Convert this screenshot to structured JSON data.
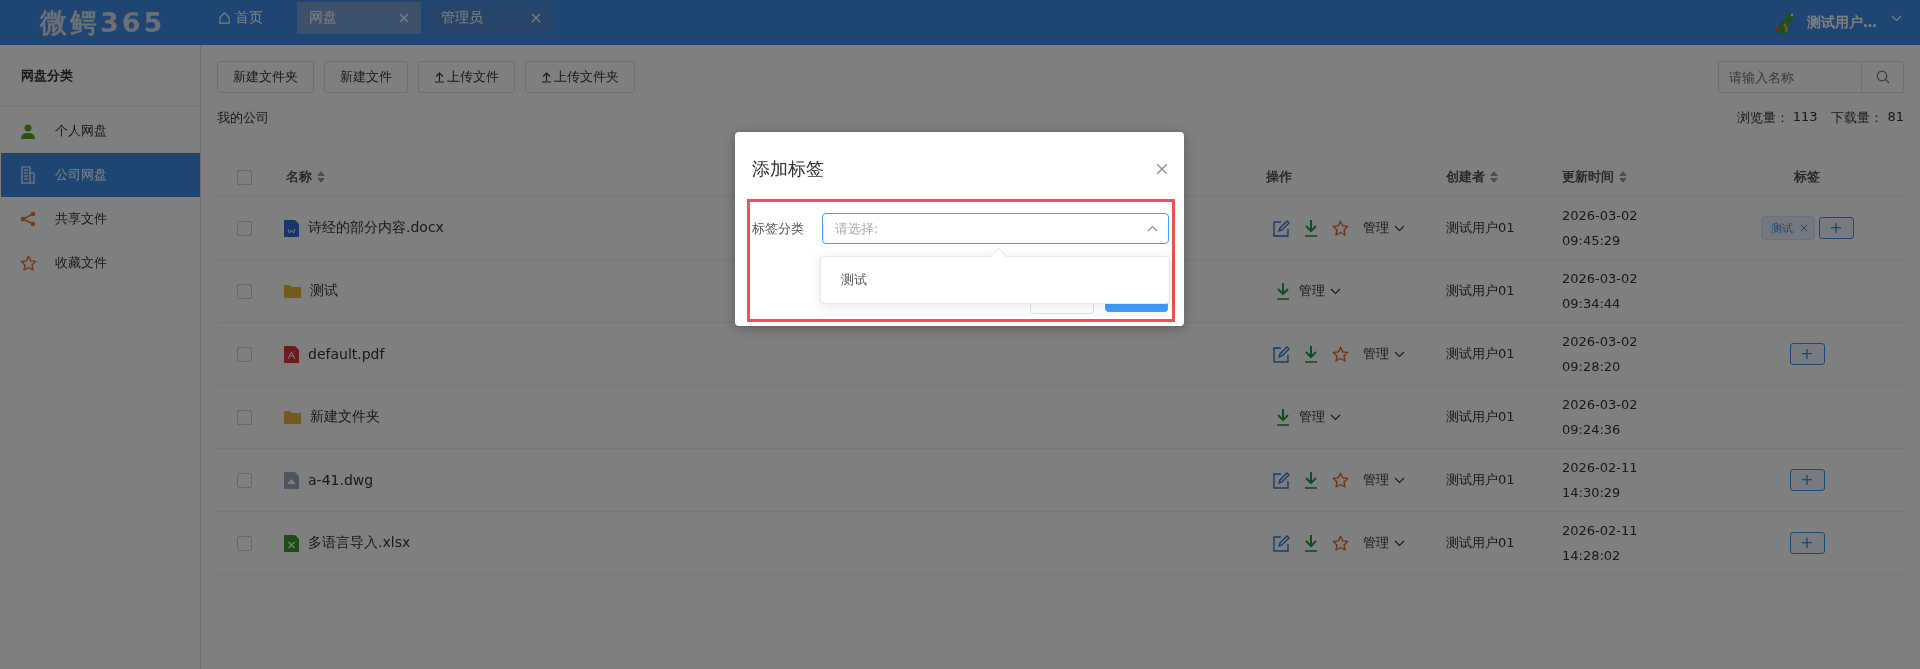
{
  "header": {
    "logo": "微鳄365",
    "tabs": [
      {
        "label": "首页",
        "kind": "home",
        "selected": false
      },
      {
        "label": "网盘",
        "kind": "closable",
        "selected": true
      },
      {
        "label": "管理员",
        "kind": "closable",
        "selected": false
      }
    ],
    "user": {
      "name": "测试用户…"
    }
  },
  "sidebar": {
    "title": "网盘分类",
    "items": [
      {
        "label": "个人网盘",
        "kind": "person",
        "selected": false
      },
      {
        "label": "公司网盘",
        "kind": "building",
        "selected": true
      },
      {
        "label": "共享文件",
        "kind": "share",
        "selected": false
      },
      {
        "label": "收藏文件",
        "kind": "star",
        "selected": false
      }
    ]
  },
  "toolbar": {
    "buttons": [
      {
        "label": "新建文件夹",
        "kind": "plain"
      },
      {
        "label": "新建文件",
        "kind": "plain"
      },
      {
        "label": "上传文件",
        "kind": "upload"
      },
      {
        "label": "上传文件夹",
        "kind": "upload"
      }
    ],
    "search": {
      "placeholder": "请输入名称"
    }
  },
  "breadcrumb": "我的公司",
  "stats": [
    {
      "label": "浏览量：",
      "value": "113"
    },
    {
      "label": "下载量：",
      "value": "81"
    }
  ],
  "table": {
    "all_checked": false,
    "columns": [
      {
        "label": "名称",
        "sortable": true
      },
      {
        "label": "操作",
        "sortable": false
      },
      {
        "label": "创建者",
        "sortable": true
      },
      {
        "label": "更新时间",
        "sortable": true
      },
      {
        "label": "标签",
        "sortable": false
      }
    ],
    "rows": [
      {
        "checked": false,
        "kind": "docx",
        "name": "诗经的部分内容.docx",
        "manage": "管理",
        "creator": "测试用户01",
        "date": "2026-03-02",
        "time": "09:45:29",
        "tags": [
          "测试"
        ],
        "add_tag": "+"
      },
      {
        "checked": false,
        "kind": "folder",
        "name": "测试",
        "manage": "管理",
        "creator": "测试用户01",
        "date": "2026-03-02",
        "time": "09:34:44",
        "tags": []
      },
      {
        "checked": false,
        "kind": "pdf",
        "name": "default.pdf",
        "manage": "管理",
        "creator": "测试用户01",
        "date": "2026-03-02",
        "time": "09:28:20",
        "tags": [],
        "add_tag": "+"
      },
      {
        "checked": false,
        "kind": "folder",
        "name": "新建文件夹",
        "manage": "管理",
        "creator": "测试用户01",
        "date": "2026-03-02",
        "time": "09:24:36",
        "tags": []
      },
      {
        "checked": false,
        "kind": "dwg",
        "name": "a-41.dwg",
        "manage": "管理",
        "creator": "测试用户01",
        "date": "2026-02-11",
        "time": "14:30:29",
        "tags": [],
        "add_tag": "+"
      },
      {
        "checked": false,
        "kind": "xlsx",
        "name": "多语言导入.xlsx",
        "manage": "管理",
        "creator": "测试用户01",
        "date": "2026-02-11",
        "time": "14:28:02",
        "tags": [],
        "add_tag": "+"
      }
    ]
  },
  "dialog": {
    "title": "添加标签",
    "field_label": "标签分类",
    "select": {
      "placeholder": "请选择:",
      "expanded": true,
      "options": [
        {
          "label": "测试",
          "selected": false
        }
      ]
    }
  }
}
